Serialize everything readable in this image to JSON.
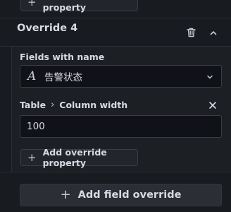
{
  "top_button": {
    "label": "Add override property"
  },
  "override": {
    "title": "Override 4",
    "matcher": {
      "label": "Fields with name",
      "value": "告警状态",
      "icon": "font-icon"
    },
    "property": {
      "category": "Table",
      "separator": "›",
      "name": "Column width",
      "value": "100"
    },
    "add_property_label": "Add override property"
  },
  "add_field_override_label": "Add field override",
  "icons": {
    "plus": "+",
    "trash": "trash-icon",
    "collapse": "chevron-up-icon",
    "dropdown": "chevron-down-icon",
    "remove": "close-icon"
  }
}
